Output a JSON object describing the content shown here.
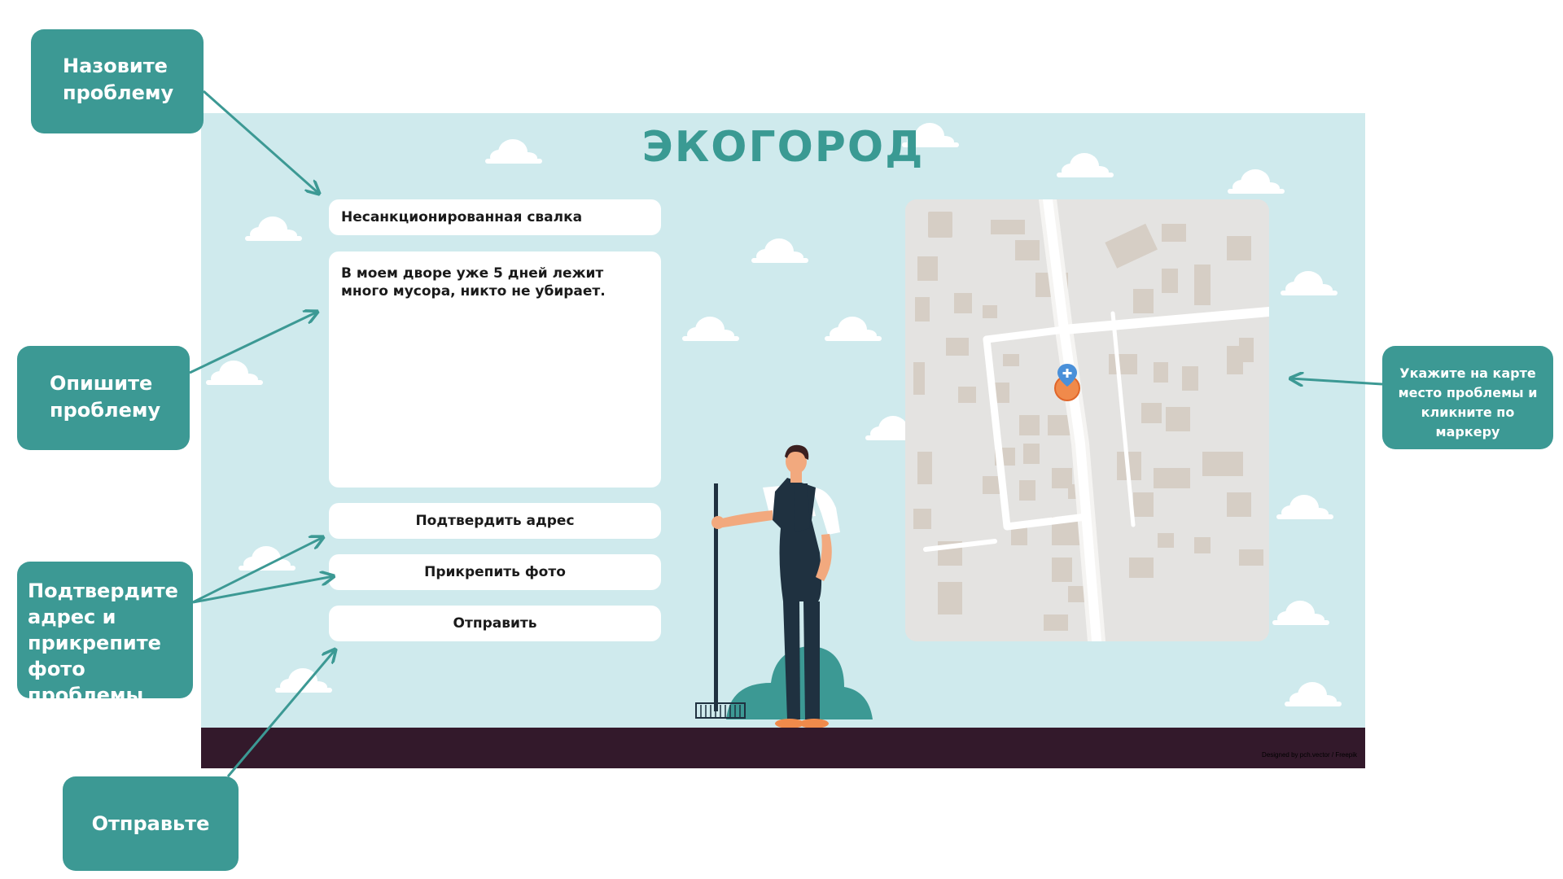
{
  "app": {
    "logo": "ЭКОГОРОД"
  },
  "form": {
    "title_value": "Несанкционированная свалка",
    "description_value": "В моем дворе уже 5 дней лежит много мусора, никто не убирает.",
    "confirm_address_label": "Подтвердить адрес",
    "attach_photo_label": "Прикрепить фото",
    "submit_label": "Отправить"
  },
  "credit": "Designed by pch.vector / Freepik",
  "callouts": {
    "name": "Назовите проблему",
    "describe": "Опишите проблему",
    "confirm": "Подтвердите адрес и прикрепите фото проблемы",
    "send": "Отправьте",
    "map": "Укажите на карте место проблемы и кликните по маркеру"
  },
  "colors": {
    "accent": "#3c9994",
    "sky": "#cfeaed",
    "ground": "#33192b",
    "marker": "#f08a4b",
    "pin": "#4a90d9"
  },
  "icons": {
    "map_marker": "map-pin-icon",
    "location": "location-circle-icon"
  }
}
